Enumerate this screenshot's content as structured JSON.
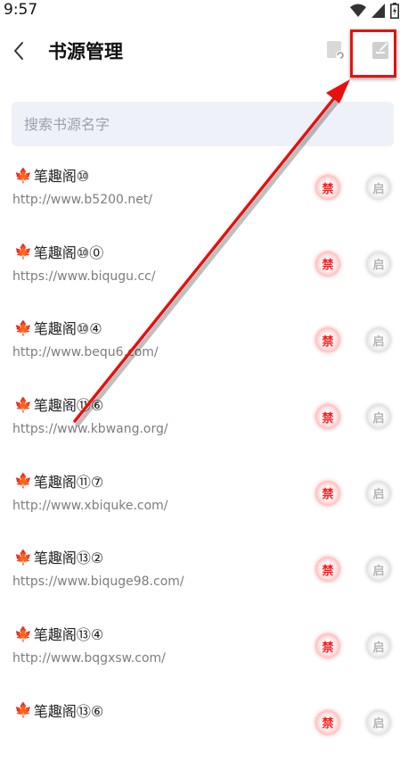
{
  "status": {
    "time": "9:57"
  },
  "header": {
    "title": "书源管理"
  },
  "search": {
    "placeholder": "搜索书源名字"
  },
  "actions": {
    "ban_label": "禁",
    "enable_label": "启"
  },
  "sources": [
    {
      "name": "笔趣阁⑩",
      "url": "http://www.b5200.net/"
    },
    {
      "name": "笔趣阁⑩⓪",
      "url": "https://www.biqugu.cc/"
    },
    {
      "name": "笔趣阁⑩④",
      "url": "http://www.bequ6.com/"
    },
    {
      "name": "笔趣阁⑪⑥",
      "url": "https://www.kbwang.org/"
    },
    {
      "name": "笔趣阁⑪⑦",
      "url": "http://www.xbiquke.com/"
    },
    {
      "name": "笔趣阁⑬②",
      "url": "https://www.biquge98.com/"
    },
    {
      "name": "笔趣阁⑬④",
      "url": "http://www.bqgxsw.com/"
    },
    {
      "name": "笔趣阁⑬⑥",
      "url": ""
    }
  ],
  "colors": {
    "accent_red": "#e8100f",
    "search_bg": "#eef1f8"
  }
}
